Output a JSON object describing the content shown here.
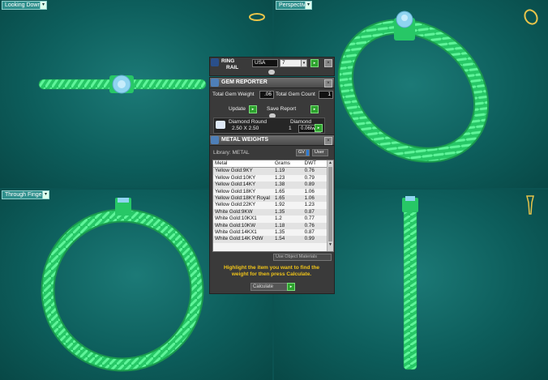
{
  "viewports": {
    "top_left": {
      "label": "Looking Down"
    },
    "top_right": {
      "label": "Perspective"
    },
    "bottom_left": {
      "label": "Through Finger"
    },
    "bottom_right": {
      "label": ""
    }
  },
  "ring_rail": {
    "title_line1": "RING",
    "title_line2": "RAIL",
    "country": "USA",
    "size": "7"
  },
  "gem_reporter": {
    "title": "GEM REPORTER",
    "total_weight_label": "Total Gem Weight",
    "total_weight_value": ".06",
    "total_count_label": "Total Gem Count",
    "total_count_value": "1",
    "update_label": "Update",
    "save_report_label": "Save Report",
    "gem": {
      "shape": "Diamond Round",
      "dims": "2.50 X 2.50",
      "material": "Diamond",
      "count": "1",
      "weight": "0.06tw"
    }
  },
  "metal_weights": {
    "title": "METAL WEIGHTS",
    "library_label": "Library: METAL",
    "gv_label": "GV",
    "user_label": "User",
    "columns": [
      "Metal",
      "Grams",
      "DWT"
    ],
    "rows": [
      [
        "Yellow Gold:9KY",
        "1.19",
        "0.76"
      ],
      [
        "Yellow Gold:10KY",
        "1.23",
        "0.79"
      ],
      [
        "Yellow Gold:14KY",
        "1.38",
        "0.89"
      ],
      [
        "Yellow Gold:18KY",
        "1.65",
        "1.06"
      ],
      [
        "Yellow Gold:18KY Royal",
        "1.65",
        "1.06"
      ],
      [
        "Yellow Gold:22KY",
        "1.92",
        "1.23"
      ],
      [
        "White Gold:9KW",
        "1.35",
        "0.87"
      ],
      [
        "White Gold:10KX1",
        "1.2",
        "0.77"
      ],
      [
        "White Gold:10KW",
        "1.18",
        "0.76"
      ],
      [
        "White Gold:14KX1",
        "1.35",
        "0.87"
      ],
      [
        "White Gold:14K PdW",
        "1.54",
        "0.99"
      ]
    ],
    "use_object_materials": "Use Object Materials",
    "hint": "Highlight the item you want to find the weight for then press Calculate.",
    "calculate_label": "Calculate"
  },
  "colors": {
    "viewport_bg": "#0d5e5c",
    "ring": "#2fe07a",
    "gem": "#8fd4f0",
    "panel_bg": "#3a3a3a",
    "hint": "#f0c419"
  }
}
